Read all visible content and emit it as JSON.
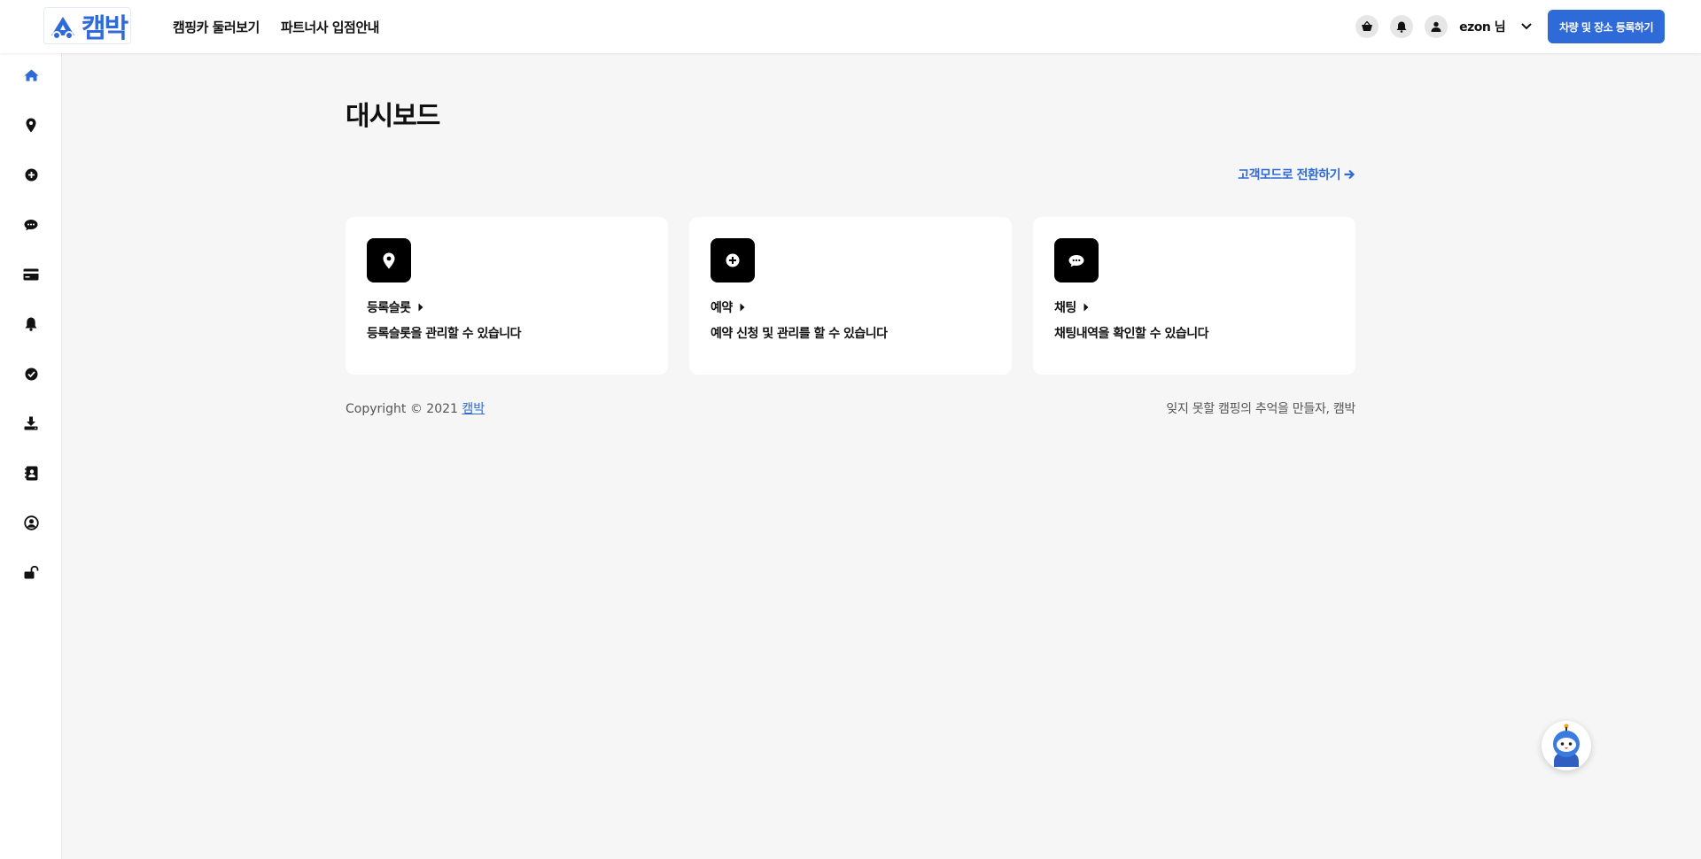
{
  "header": {
    "logo_text": "캠박",
    "nav": [
      "캠핑카 둘러보기",
      "파트너사 입점안내"
    ],
    "user_name": "ezon 님",
    "register_button": "차량 및 장소 등록하기"
  },
  "sidebar": {
    "items": [
      {
        "icon": "home-icon",
        "active": true
      },
      {
        "icon": "map-pin-icon"
      },
      {
        "icon": "plus-circle-icon"
      },
      {
        "icon": "chat-icon"
      },
      {
        "icon": "credit-card-icon"
      },
      {
        "icon": "bell-icon"
      },
      {
        "icon": "check-circle-icon"
      },
      {
        "icon": "download-icon"
      },
      {
        "icon": "address-book-icon"
      },
      {
        "icon": "user-circle-icon"
      },
      {
        "icon": "unlock-icon"
      }
    ]
  },
  "main": {
    "title": "대시보드",
    "switch_link": "고객모드로 전환하기",
    "cards": [
      {
        "icon": "map-pin-icon",
        "title": "등록슬롯",
        "desc": "등록슬롯을 관리할 수 있습니다"
      },
      {
        "icon": "plus-circle-icon",
        "title": "예약",
        "desc": "예약 신청 및 관리를 할 수 있습니다"
      },
      {
        "icon": "chat-icon",
        "title": "채팅",
        "desc": "채팅내역을 확인할 수 있습니다"
      }
    ]
  },
  "footer": {
    "copyright": "Copyright © 2021",
    "link": "캠박",
    "slogan": "잊지 못할 캠핑의 추억을 만들자, 캠박"
  },
  "colors": {
    "accent": "#2f6bd8",
    "background": "#f6f6f6"
  }
}
